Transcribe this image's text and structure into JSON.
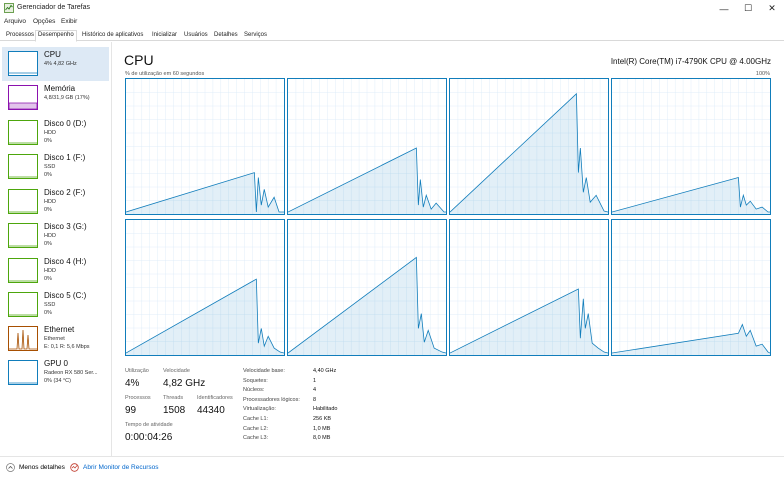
{
  "window": {
    "title": "Gerenciador de Tarefas",
    "controls": {
      "minimize": "—",
      "maximize": "☐",
      "close": "✕"
    }
  },
  "menu": [
    "Arquivo",
    "Opções",
    "Exibir"
  ],
  "tabs": [
    {
      "label": "Processos",
      "active": false
    },
    {
      "label": "Desempenho",
      "active": true
    },
    {
      "label": "Histórico de aplicativos",
      "active": false
    },
    {
      "label": "Inicializar",
      "active": false
    },
    {
      "label": "Usuários",
      "active": false
    },
    {
      "label": "Detalhes",
      "active": false
    },
    {
      "label": "Serviços",
      "active": false
    }
  ],
  "resources": [
    {
      "name": "CPU",
      "sub1": "4% 4,82 GHz",
      "sub2": "",
      "color": "#117dbb",
      "selected": true
    },
    {
      "name": "Memória",
      "sub1": "4,8/31,9 GB (17%)",
      "sub2": "",
      "color": "#8b12ae",
      "selected": false
    },
    {
      "name": "Disco 0 (D:)",
      "sub1": "HDD",
      "sub2": "0%",
      "color": "#4da60c",
      "selected": false
    },
    {
      "name": "Disco 1 (F:)",
      "sub1": "SSD",
      "sub2": "0%",
      "color": "#4da60c",
      "selected": false
    },
    {
      "name": "Disco 2 (F:)",
      "sub1": "HDD",
      "sub2": "0%",
      "color": "#4da60c",
      "selected": false
    },
    {
      "name": "Disco 3 (G:)",
      "sub1": "HDD",
      "sub2": "0%",
      "color": "#4da60c",
      "selected": false
    },
    {
      "name": "Disco 4 (H:)",
      "sub1": "HDD",
      "sub2": "0%",
      "color": "#4da60c",
      "selected": false
    },
    {
      "name": "Disco 5 (C:)",
      "sub1": "SSD",
      "sub2": "0%",
      "color": "#4da60c",
      "selected": false
    },
    {
      "name": "Ethernet",
      "sub1": "Ethernet",
      "sub2": "E: 0,1 R: 5,6 Mbps",
      "color": "#a74f01",
      "selected": false
    },
    {
      "name": "GPU 0",
      "sub1": "Radeon RX 580 Ser...",
      "sub2": "0% (34 °C)",
      "color": "#117dbb",
      "selected": false
    }
  ],
  "cpu": {
    "title": "CPU",
    "model": "Intel(R) Core(TM) i7-4790K CPU @ 4.00GHz",
    "graph_caption": "% de utilização em 60 segundos",
    "graph_max": "100%",
    "graph_color": "#117dbb"
  },
  "stats": {
    "utilizacao_label": "Utilização",
    "utilizacao": "4%",
    "velocidade_label": "Velocidade",
    "velocidade": "4,82 GHz",
    "processos_label": "Processos",
    "processos": "99",
    "threads_label": "Threads",
    "threads": "1508",
    "identificadores_label": "Identificadores",
    "identificadores": "44340",
    "tempo_label": "Tempo de atividade",
    "tempo": "0:00:04:26"
  },
  "details": [
    {
      "label": "Velocidade base:",
      "value": "4,40 GHz"
    },
    {
      "label": "Soquetes:",
      "value": "1"
    },
    {
      "label": "Núcleos:",
      "value": "4"
    },
    {
      "label": "Processadores lógicos:",
      "value": "8"
    },
    {
      "label": "Virtualização:",
      "value": "Habilitado"
    },
    {
      "label": "Cache L1:",
      "value": "256 KB"
    },
    {
      "label": "Cache L2:",
      "value": "1,0 MB"
    },
    {
      "label": "Cache L3:",
      "value": "8,0 MB"
    }
  ],
  "footer": {
    "menos_detalhes": "Menos detalhes",
    "monitor": "Abrir Monitor de Recursos"
  }
}
